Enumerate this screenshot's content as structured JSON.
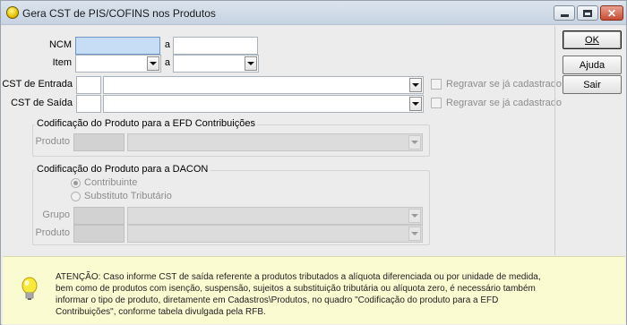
{
  "window": {
    "title": "Gera CST de PIS/COFINS nos Produtos"
  },
  "filters": {
    "ncm_label": "NCM",
    "ncm_from": "",
    "ncm_to": "",
    "item_label": "Item",
    "item_from": "",
    "item_to": "",
    "range_sep": "a"
  },
  "cst": {
    "entrada_label": "CST de Entrada",
    "entrada_code": "",
    "entrada_desc": "",
    "saida_label": "CST de Saída",
    "saida_code": "",
    "saida_desc": "",
    "regravar_label": "Regravar se já cadastrado"
  },
  "efd_group": {
    "title": "Codificação do Produto para a EFD Contribuições",
    "produto_label": "Produto"
  },
  "dacon_group": {
    "title": "Codificação do Produto para a DACON",
    "radio_contribuinte": "Contribuinte",
    "radio_substituto": "Substituto Tributário",
    "selected": "Contribuinte",
    "grupo_label": "Grupo",
    "produto_label": "Produto"
  },
  "buttons": {
    "ok": "OK",
    "ajuda": "Ajuda",
    "sair": "Sair"
  },
  "note": {
    "text": "ATENÇÃO: Caso informe CST de saída referente a produtos tributados a alíquota diferenciada ou por unidade de medida, bem como de produtos com isenção, suspensão, sujeitos a substituição tributária ou alíquota zero, é necessário também informar o tipo de produto, diretamente em Cadastros\\Produtos,  no quadro \"Codificação do produto para a EFD Contribuições\", conforme tabela divulgada pela RFB."
  },
  "colors": {
    "focus_field": "#c7dcf5",
    "note_background": "#fbfbd2",
    "dialog_background": "#ececec"
  }
}
